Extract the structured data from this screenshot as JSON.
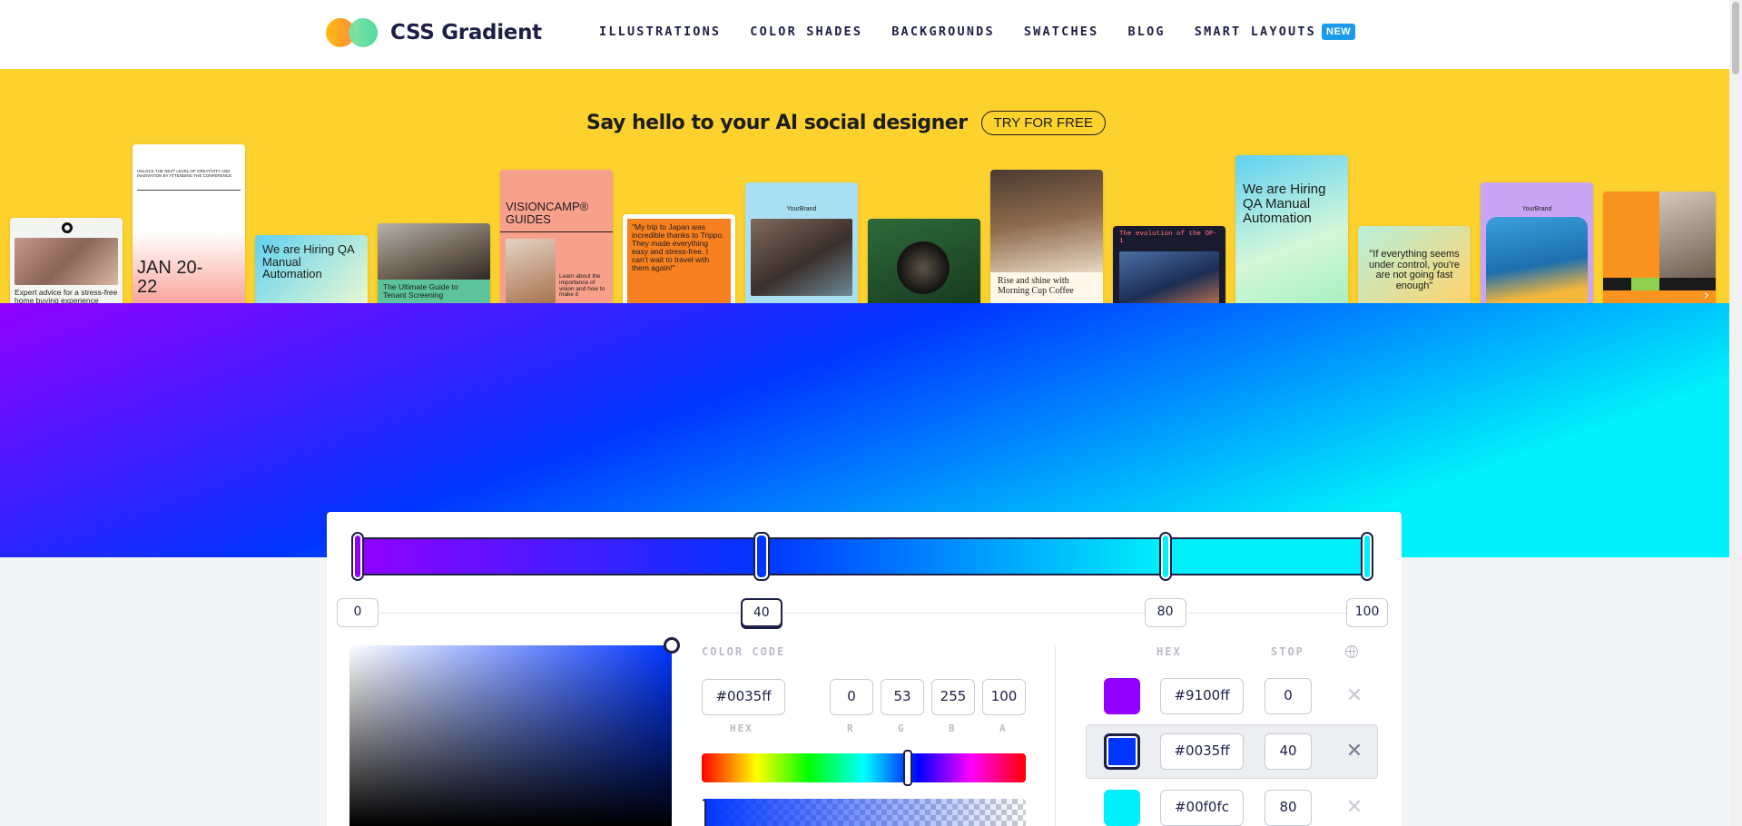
{
  "header": {
    "logo_text": "CSS Gradient",
    "nav": [
      "ILLUSTRATIONS",
      "COLOR SHADES",
      "BACKGROUNDS",
      "SWATCHES",
      "BLOG",
      "SMART LAYOUTS"
    ],
    "new_badge": "NEW"
  },
  "ad": {
    "headline": "Say hello to your AI social designer",
    "cta": "TRY FOR FREE",
    "cards": [
      "Expert advice for a stress-free home buying experience",
      "UNLOCK THE NEXT LEVEL OF CREATIVITY AND INNOVATION BY ATTENDING THE CONFERENCE",
      "JAN 20-22",
      "We are Hiring QA Manual Automation",
      "The Ultimate Guide to Tenant Screening",
      "VISIONCAMP® GUIDES",
      "Learn about the importance of vision and how to make it",
      "\"My trip to Japan was incredible thanks to Trippo. They made everything easy and stress-free. I can't wait to travel with them again!\"",
      "YourBrand",
      "Rise and shine with Morning Cup Coffee",
      "The evolution of the OP-1",
      "We are Hiring QA Manual Automation",
      "\"If everything seems under control, you're are not going fast enough\"",
      "YourBrand"
    ]
  },
  "gradient": {
    "colors": [
      "#9100ff",
      "#0035ff",
      "#00f0fc",
      "#00f0fc"
    ],
    "positions": [
      0,
      40,
      80,
      100
    ],
    "selected_index": 1
  },
  "picker": {
    "section_label": "COLOR CODE",
    "hex": "#0035ff",
    "r": "0",
    "g": "53",
    "b": "255",
    "a": "100",
    "hex_label": "HEX",
    "r_label": "R",
    "g_label": "G",
    "b_label": "B",
    "a_label": "A",
    "hue_percent": 63.5,
    "alpha_percent": 100
  },
  "stops_table": {
    "hex_header": "HEX",
    "stop_header": "STOP",
    "rows": [
      {
        "hex": "#9100ff",
        "stop": "0",
        "color": "#9100ff"
      },
      {
        "hex": "#0035ff",
        "stop": "40",
        "color": "#0035ff"
      },
      {
        "hex": "#00f0fc",
        "stop": "80",
        "color": "#00f0fc"
      }
    ]
  },
  "pos_chips": [
    "0",
    "40",
    "80",
    "100"
  ]
}
